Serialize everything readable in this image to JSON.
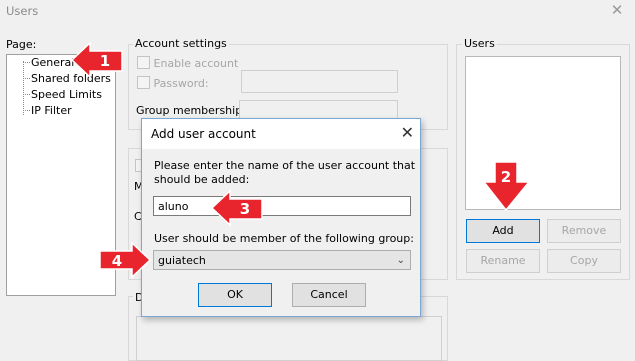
{
  "window": {
    "title": "Users",
    "close_glyph": "✕"
  },
  "page": {
    "label": "Page:",
    "items": [
      {
        "label": "General",
        "selected": true
      },
      {
        "label": "Shared folders"
      },
      {
        "label": "Speed Limits"
      },
      {
        "label": "IP Filter"
      }
    ]
  },
  "account_settings": {
    "group_label": "Account settings",
    "enable_account": "Enable account",
    "password": "Password:",
    "group_membership": "Group membership:",
    "partial_labels": {
      "m": "M",
      "c": "C",
      "d": "D"
    }
  },
  "users": {
    "group_label": "Users",
    "buttons": {
      "add": "Add",
      "remove": "Remove",
      "rename": "Rename",
      "copy": "Copy"
    }
  },
  "dialog": {
    "title": "Add user account",
    "close_glyph": "✕",
    "prompt": "Please enter the name of the user account that should be added:",
    "username_value": "aluno",
    "group_prompt": "User should be member of the following group:",
    "group_value": "guiatech",
    "ok": "OK",
    "cancel": "Cancel"
  },
  "annotations": {
    "color": "#e8242c",
    "steps": [
      "1",
      "2",
      "3",
      "4"
    ]
  }
}
